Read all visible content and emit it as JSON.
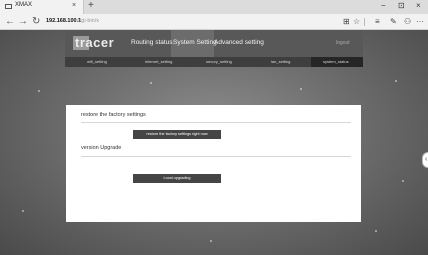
{
  "browser": {
    "tab_title": "XMAX",
    "tab_close": "×",
    "new_tab": "+",
    "window_controls": [
      "−",
      "⊡",
      "×"
    ],
    "nav": {
      "back": "←",
      "forward": "→",
      "refresh": "↻"
    },
    "address": {
      "host": "192.168.100.1",
      "path": "/cgi-bin/x"
    },
    "toolbar": {
      "reader": "⊞",
      "favorite": "☆",
      "hub": "≡",
      "notes": "✎",
      "share": "⚇",
      "more": "···"
    }
  },
  "router": {
    "logo_text": "tracer",
    "menu": [
      "Routing status",
      "System Setting",
      "Advanced setting"
    ],
    "active_menu": "System Setting",
    "logout": "logout",
    "submenu": [
      "wifi_setting",
      "internet_setting",
      "secury_setting",
      "lan_setting",
      "system_status"
    ],
    "active_submenu": "system_status"
  },
  "panel": {
    "factory_title": "restore the factory settings",
    "factory_button": "restore the factory settings right now",
    "upgrade_title": "version Upgrade",
    "upgrade_button": "Local upgrading"
  },
  "colors": {
    "header_bg": "#585858",
    "subnav_bg": "#3e3e3e",
    "button_bg": "#454545"
  }
}
